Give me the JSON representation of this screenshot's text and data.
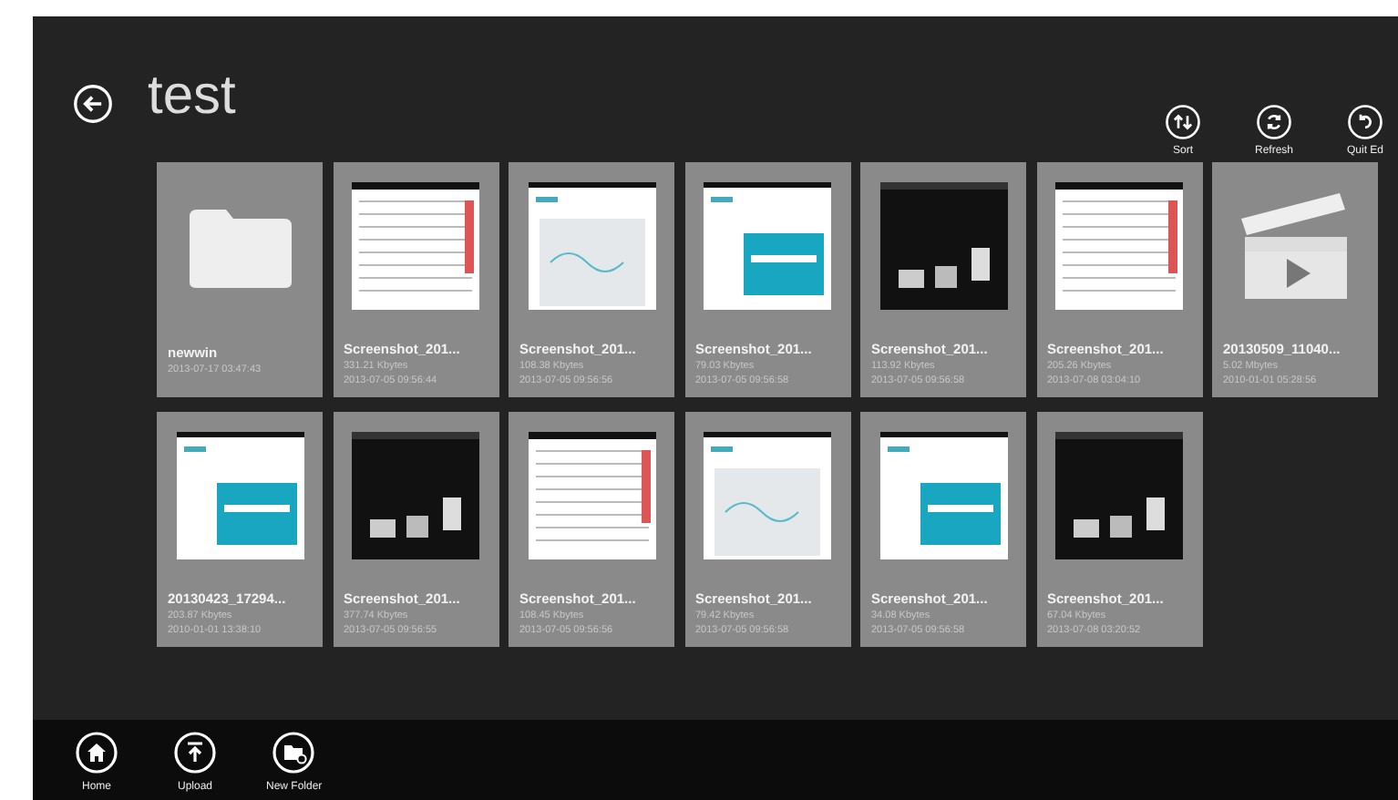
{
  "header": {
    "title": "test"
  },
  "commands": [
    {
      "label": "Sort",
      "kind": "sort"
    },
    {
      "label": "Refresh",
      "kind": "refresh"
    },
    {
      "label": "Quit Ed",
      "kind": "undo"
    }
  ],
  "rows": [
    [
      {
        "kind": "folder",
        "name": "newwin",
        "date": "2013-07-17 03:47:43"
      },
      {
        "kind": "picture",
        "name": "Screenshot_201...",
        "size": "331.21 Kbytes",
        "date": "2013-07-05 09:56:44"
      },
      {
        "kind": "picture",
        "name": "Screenshot_201...",
        "size": "108.38 Kbytes",
        "date": "2013-07-05 09:56:56"
      },
      {
        "kind": "picture",
        "name": "Screenshot_201...",
        "size": "79.03 Kbytes",
        "date": "2013-07-05 09:56:58"
      },
      {
        "kind": "picture",
        "name": "Screenshot_201...",
        "size": "113.92 Kbytes",
        "date": "2013-07-05 09:56:58"
      },
      {
        "kind": "picture",
        "name": "Screenshot_201...",
        "size": "205.26 Kbytes",
        "date": "2013-07-08 03:04:10"
      },
      {
        "kind": "video",
        "name": "20130509_11040...",
        "size": "5.02 Mbytes",
        "date": "2010-01-01 05:28:56"
      }
    ],
    [
      {
        "kind": "picture",
        "name": "20130423_17294...",
        "size": "203.87 Kbytes",
        "date": "2010-01-01 13:38:10"
      },
      {
        "kind": "picture",
        "name": "Screenshot_201...",
        "size": "377.74 Kbytes",
        "date": "2013-07-05 09:56:55"
      },
      {
        "kind": "picture",
        "name": "Screenshot_201...",
        "size": "108.45 Kbytes",
        "date": "2013-07-05 09:56:56"
      },
      {
        "kind": "picture",
        "name": "Screenshot_201...",
        "size": "79.42 Kbytes",
        "date": "2013-07-05 09:56:58"
      },
      {
        "kind": "picture",
        "name": "Screenshot_201...",
        "size": "34.08 Kbytes",
        "date": "2013-07-05 09:56:58"
      },
      {
        "kind": "picture",
        "name": "Screenshot_201...",
        "size": "67.04 Kbytes",
        "date": "2013-07-08 03:20:52"
      }
    ]
  ],
  "app_bar": [
    {
      "label": "Home",
      "kind": "home"
    },
    {
      "label": "Upload",
      "kind": "upload"
    },
    {
      "label": "New Folder",
      "kind": "folder"
    }
  ]
}
